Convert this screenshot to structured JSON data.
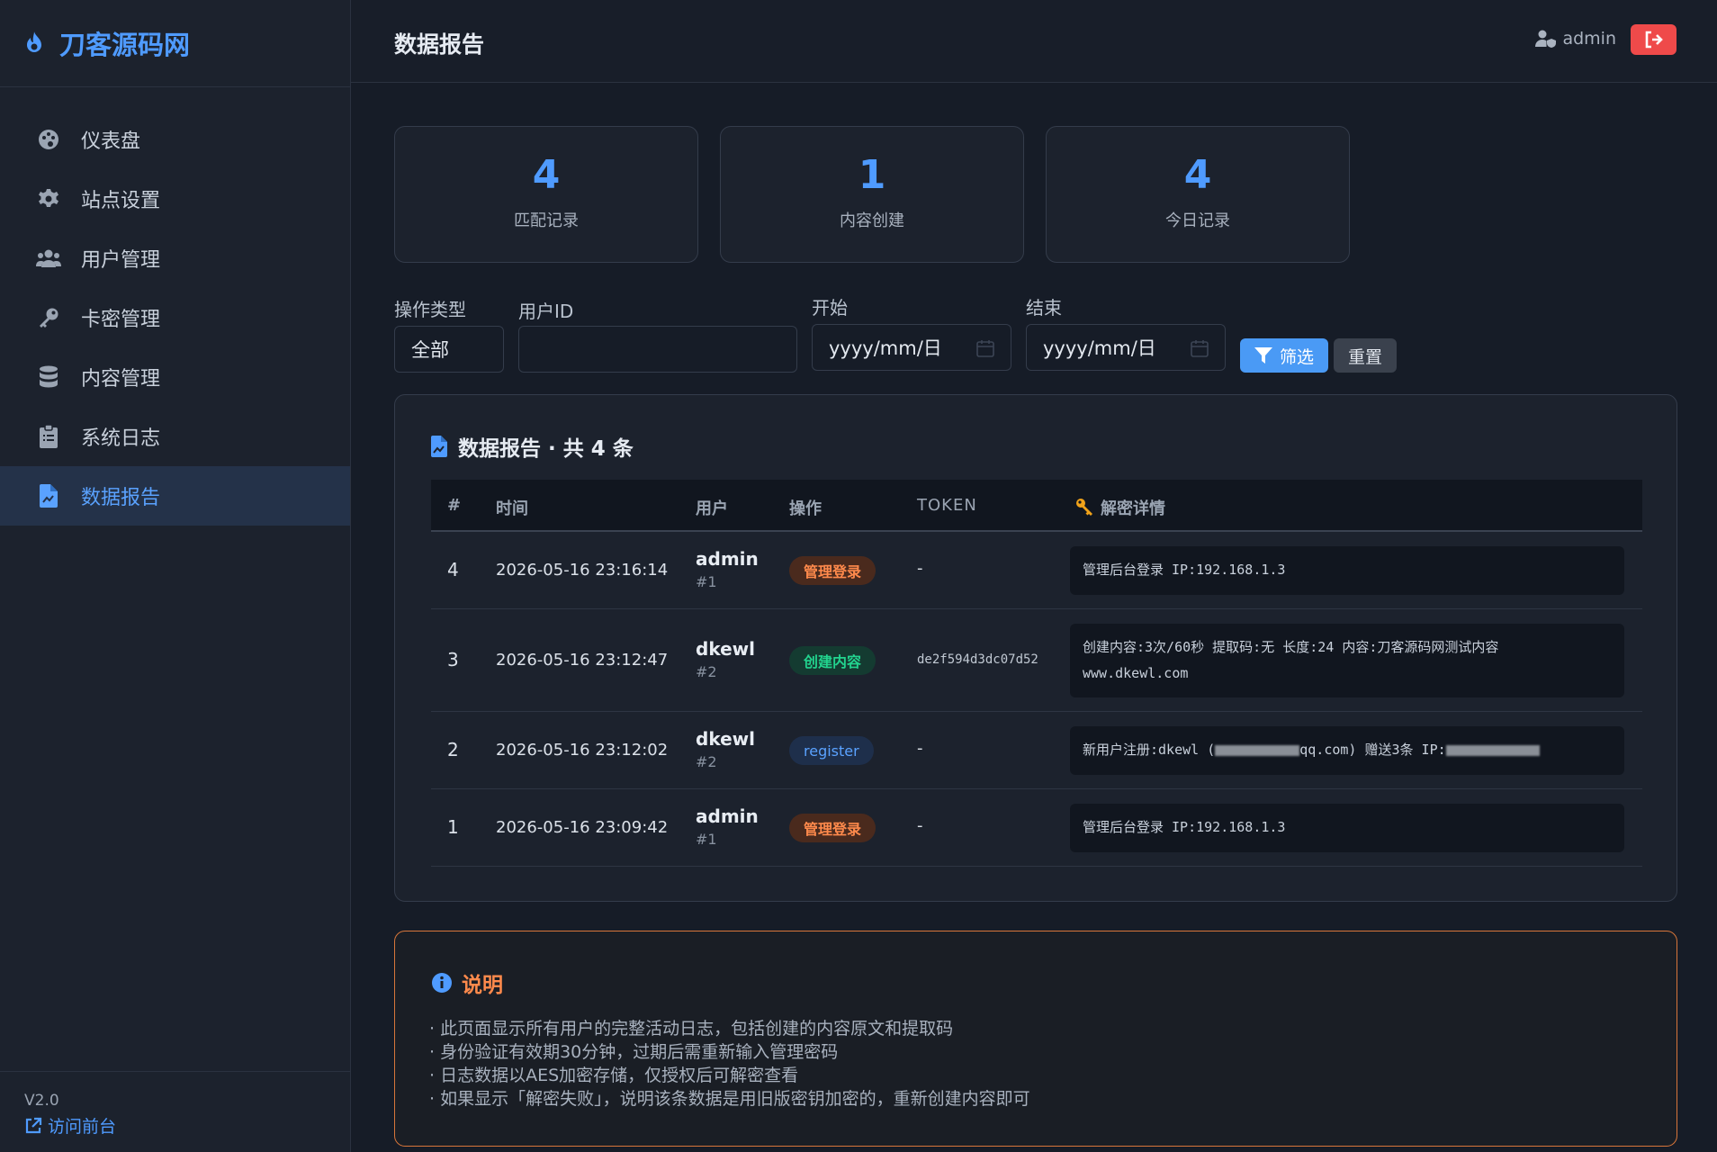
{
  "brand": {
    "name": "刀客源码网"
  },
  "sidebar": {
    "items": [
      {
        "label": "仪表盘",
        "icon": "palette-icon"
      },
      {
        "label": "站点设置",
        "icon": "gear-icon"
      },
      {
        "label": "用户管理",
        "icon": "users-icon"
      },
      {
        "label": "卡密管理",
        "icon": "key-icon"
      },
      {
        "label": "内容管理",
        "icon": "database-icon"
      },
      {
        "label": "系统日志",
        "icon": "clipboard-icon"
      },
      {
        "label": "数据报告",
        "icon": "file-chart-icon",
        "active": true
      }
    ],
    "version": "V2.0",
    "visit_label": "访问前台"
  },
  "header": {
    "title": "数据报告",
    "username": "admin"
  },
  "stats": [
    {
      "value": "4",
      "label": "匹配记录"
    },
    {
      "value": "1",
      "label": "内容创建"
    },
    {
      "value": "4",
      "label": "今日记录"
    }
  ],
  "filters": {
    "type_label": "操作类型",
    "type_value": "全部",
    "userid_label": "用户ID",
    "userid_value": "",
    "start_label": "开始",
    "start_value": "yyyy/mm/日",
    "end_label": "结束",
    "end_value": "yyyy/mm/日",
    "filter_button": "筛选",
    "reset_button": "重置"
  },
  "report": {
    "title": "数据报告 · 共 4 条",
    "columns": [
      "#",
      "时间",
      "用户",
      "操作",
      "TOKEN",
      "解密详情"
    ],
    "rows": [
      {
        "id": "4",
        "time": "2026-05-16 23:16:14",
        "user": "admin",
        "uid": "#1",
        "action": "管理登录",
        "action_type": "login",
        "token": "-",
        "detail": "管理后台登录 IP:192.168.1.3"
      },
      {
        "id": "3",
        "time": "2026-05-16 23:12:47",
        "user": "dkewl",
        "uid": "#2",
        "action": "创建内容",
        "action_type": "create",
        "token": "de2f594d3dc07d52",
        "detail": "创建内容:3次/60秒 提取码:无 长度:24 内容:刀客源码网测试内容  www.dkewl.com"
      },
      {
        "id": "2",
        "time": "2026-05-16 23:12:02",
        "user": "dkewl",
        "uid": "#2",
        "action": "register",
        "action_type": "register",
        "token": "-",
        "detail_prefix": "新用户注册:dkewl (",
        "detail_mid": "qq.com) 赠送3条 IP:"
      },
      {
        "id": "1",
        "time": "2026-05-16 23:09:42",
        "user": "admin",
        "uid": "#1",
        "action": "管理登录",
        "action_type": "login",
        "token": "-",
        "detail": "管理后台登录 IP:192.168.1.3"
      }
    ]
  },
  "notice": {
    "title": "说明",
    "lines": [
      "· 此页面显示所有用户的完整活动日志，包括创建的内容原文和提取码",
      "· 身份验证有效期30分钟，过期后需重新输入管理密码",
      "· 日志数据以AES加密存储，仅授权后可解密查看",
      "· 如果显示「解密失败」，说明该条数据是用旧版密钥加密的，重新创建内容即可"
    ]
  },
  "colors": {
    "accent": "#4f9bff",
    "danger": "#ef4a4a",
    "warning": "#ff8a4c",
    "success": "#22d38e"
  }
}
